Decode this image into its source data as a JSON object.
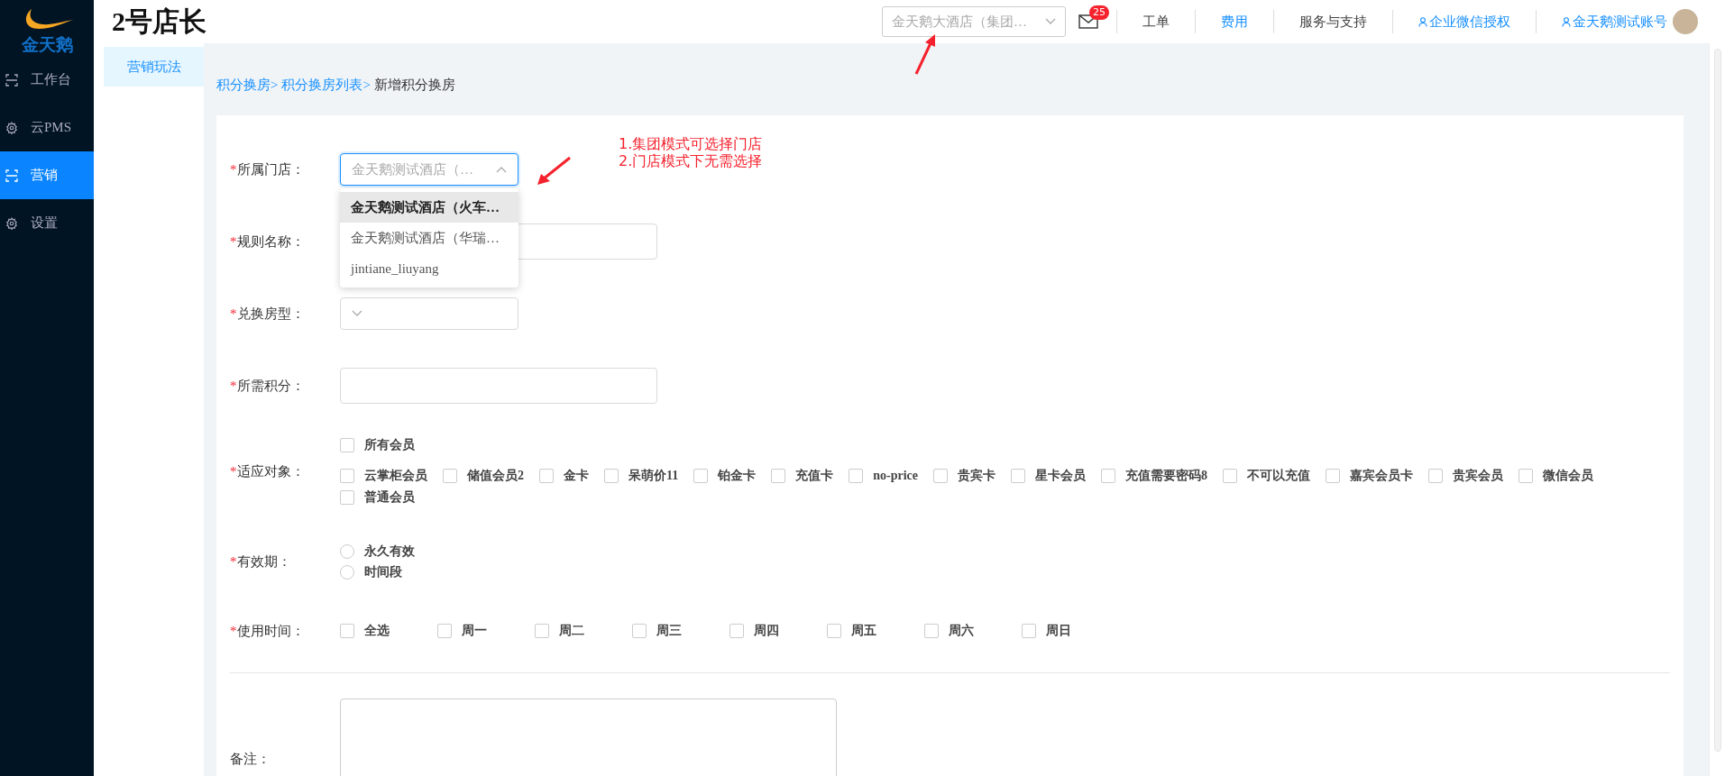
{
  "logo": {
    "text": "金天鹅"
  },
  "sidebar": {
    "items": [
      {
        "label": "工作台",
        "kind": "frame",
        "selected": false
      },
      {
        "label": "云PMS",
        "kind": "gear",
        "selected": false
      },
      {
        "label": "营销",
        "kind": "frame",
        "selected": true
      },
      {
        "label": "设置",
        "kind": "gear",
        "selected": false
      }
    ]
  },
  "header": {
    "title": "2号店长",
    "hotel_select": {
      "value": "金天鹅大酒店（集团…"
    },
    "messages": {
      "count": "25"
    },
    "links": [
      {
        "label": "工单",
        "highlighted": false,
        "user_icon": false
      },
      {
        "label": "费用",
        "highlighted": true,
        "user_icon": false
      },
      {
        "label": "服务与支持",
        "highlighted": false,
        "user_icon": false
      },
      {
        "label": "企业微信授权",
        "highlighted": true,
        "user_icon": true
      },
      {
        "label": "金天鹅测试账号",
        "highlighted": true,
        "user_icon": true
      }
    ]
  },
  "subnav": {
    "items": [
      {
        "label": "营销玩法",
        "selected": true
      }
    ]
  },
  "breadcrumb": [
    {
      "label": "积分换房>",
      "link": true
    },
    {
      "label": "积分换房列表>",
      "link": true
    },
    {
      "label": "新增积分换房",
      "link": false
    }
  ],
  "annotations": [
    {
      "text": "1.集团模式可选择门店"
    },
    {
      "text": "2.门店模式下无需选择"
    }
  ],
  "form": {
    "fields": [
      {
        "kind": "select",
        "required_mark": "*",
        "label": "所属门店：",
        "value": "金天鹅测试酒店（…",
        "open": true,
        "options": [
          {
            "label": "金天鹅测试酒店（火车…",
            "highlighted": true
          },
          {
            "label": "金天鹅测试酒店（华瑞…",
            "highlighted": false
          },
          {
            "label": "jintiane_liuyang",
            "highlighted": false
          }
        ]
      },
      {
        "kind": "input",
        "required_mark": "*",
        "label": "规则名称："
      },
      {
        "kind": "select",
        "required_mark": "*",
        "label": "兑换房型：",
        "open": false
      },
      {
        "kind": "input",
        "required_mark": "*",
        "label": "所需积分："
      },
      {
        "kind": "checkbox-group",
        "required_mark": "*",
        "label": "适应对象：",
        "all": {
          "label": "所有会员",
          "checked": false
        },
        "options": [
          {
            "label": "云掌柜会员",
            "checked": false
          },
          {
            "label": "储值会员2",
            "checked": false
          },
          {
            "label": "金卡",
            "checked": false
          },
          {
            "label": "呆萌价11",
            "checked": false
          },
          {
            "label": "铂金卡",
            "checked": false
          },
          {
            "label": "充值卡",
            "checked": false
          },
          {
            "label": "no-price",
            "checked": false
          },
          {
            "label": "贵宾卡",
            "checked": false
          },
          {
            "label": "星卡会员",
            "checked": false
          },
          {
            "label": "充值需要密码8",
            "checked": false
          },
          {
            "label": "不可以充值",
            "checked": false
          },
          {
            "label": "嘉宾会员卡",
            "checked": false
          },
          {
            "label": "贵宾会员",
            "checked": false
          },
          {
            "label": "微信会员",
            "checked": false
          },
          {
            "label": "普通会员",
            "checked": false
          }
        ]
      },
      {
        "kind": "radio-group",
        "required_mark": "*",
        "label": "有效期：",
        "options": [
          {
            "label": "永久有效",
            "selected": false
          },
          {
            "label": "时间段",
            "selected": false
          }
        ]
      },
      {
        "kind": "checkbox-row",
        "required_mark": "*",
        "label": "使用时间：",
        "options": [
          {
            "label": "全选",
            "checked": false
          },
          {
            "label": "周一",
            "checked": false
          },
          {
            "label": "周二",
            "checked": false
          },
          {
            "label": "周三",
            "checked": false
          },
          {
            "label": "周四",
            "checked": false
          },
          {
            "label": "周五",
            "checked": false
          },
          {
            "label": "周六",
            "checked": false
          },
          {
            "label": "周日",
            "checked": false
          }
        ]
      },
      {
        "kind": "divider"
      },
      {
        "kind": "textarea",
        "label": "备注："
      }
    ]
  }
}
